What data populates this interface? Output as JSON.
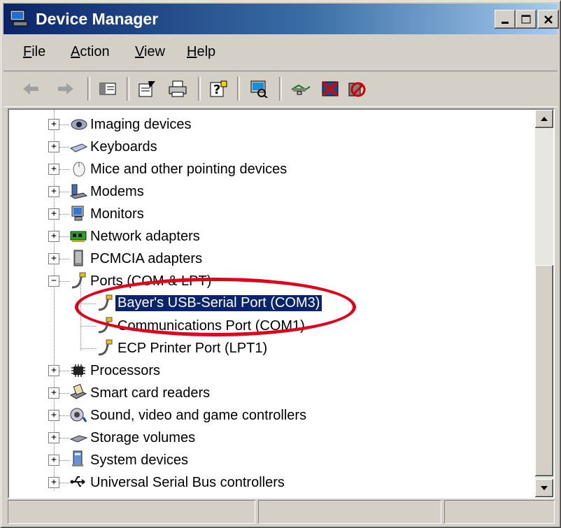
{
  "window": {
    "title": "Device Manager",
    "title_icon": "device-manager-icon"
  },
  "menu": [
    {
      "label": "File"
    },
    {
      "label": "Action"
    },
    {
      "label": "View"
    },
    {
      "label": "Help"
    }
  ],
  "toolbar": [
    "back-icon",
    "forward-icon",
    "show-hide-tree-icon",
    "properties-icon",
    "print-icon",
    "help-icon",
    "scan-hardware-icon",
    "update-driver-icon",
    "uninstall-icon",
    "disable-icon"
  ],
  "tree": {
    "items": [
      {
        "label": "Imaging devices",
        "icon": "camera-icon",
        "expanded": false
      },
      {
        "label": "Keyboards",
        "icon": "keyboard-icon",
        "expanded": false
      },
      {
        "label": "Mice and other pointing devices",
        "icon": "mouse-icon",
        "expanded": false
      },
      {
        "label": "Modems",
        "icon": "modem-icon",
        "expanded": false
      },
      {
        "label": "Monitors",
        "icon": "monitor-icon",
        "expanded": false
      },
      {
        "label": "Network adapters",
        "icon": "network-adapter-icon",
        "expanded": false
      },
      {
        "label": "PCMCIA adapters",
        "icon": "pcmcia-icon",
        "expanded": false
      },
      {
        "label": "Ports (COM & LPT)",
        "icon": "port-icon",
        "expanded": true,
        "children": [
          {
            "label": "Bayer's USB-Serial Port (COM3)",
            "icon": "port-icon",
            "selected": true
          },
          {
            "label": "Communications Port (COM1)",
            "icon": "port-icon"
          },
          {
            "label": "ECP Printer Port (LPT1)",
            "icon": "port-icon"
          }
        ]
      },
      {
        "label": "Processors",
        "icon": "processor-icon",
        "expanded": false
      },
      {
        "label": "Smart card readers",
        "icon": "smart-card-reader-icon",
        "expanded": false
      },
      {
        "label": "Sound, video and game controllers",
        "icon": "sound-icon",
        "expanded": false
      },
      {
        "label": "Storage volumes",
        "icon": "storage-icon",
        "expanded": false
      },
      {
        "label": "System devices",
        "icon": "system-devices-icon",
        "expanded": false
      },
      {
        "label": "Universal Serial Bus controllers",
        "icon": "usb-icon",
        "expanded": false
      }
    ]
  },
  "annotation": {
    "color": "#e0001b"
  },
  "colors": {
    "titlebar": "#0a246a",
    "selection": "#0a246a"
  }
}
